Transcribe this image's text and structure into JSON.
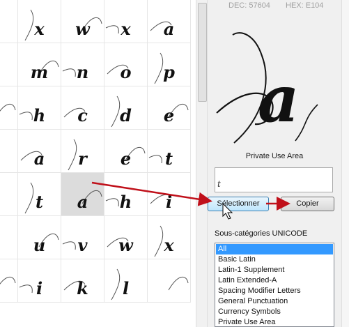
{
  "grid": {
    "rows": [
      [
        "",
        "x",
        "w",
        "x",
        "a"
      ],
      [
        "",
        "m",
        "n",
        "o",
        "p"
      ],
      [
        "",
        "h",
        "c",
        "d",
        "e"
      ],
      [
        "",
        "a",
        "r",
        "e",
        "t"
      ],
      [
        "",
        "t",
        "a",
        "h",
        "i"
      ],
      [
        "",
        "u",
        "v",
        "w",
        "x"
      ],
      [
        "",
        "i",
        "k",
        "l",
        ""
      ]
    ],
    "selected_cell": "4-2"
  },
  "info": {
    "dec": "DEC: 57604",
    "hex": "HEX: E104",
    "preview_char": "a",
    "block_name": "Private Use Area",
    "char_box_value": "t"
  },
  "buttons": {
    "select": "Sélectionner",
    "copy": "Copier"
  },
  "categories": {
    "label": "Sous-catégories UNICODE",
    "items": [
      "All",
      "Basic Latin",
      "Latin-1 Supplement",
      "Latin Extended-A",
      "Spacing Modifier Letters",
      "General Punctuation",
      "Currency Symbols",
      "Private Use Area"
    ],
    "selected_index": 0
  },
  "colors": {
    "arrow": "#c0101a",
    "selection": "#3399ff"
  }
}
